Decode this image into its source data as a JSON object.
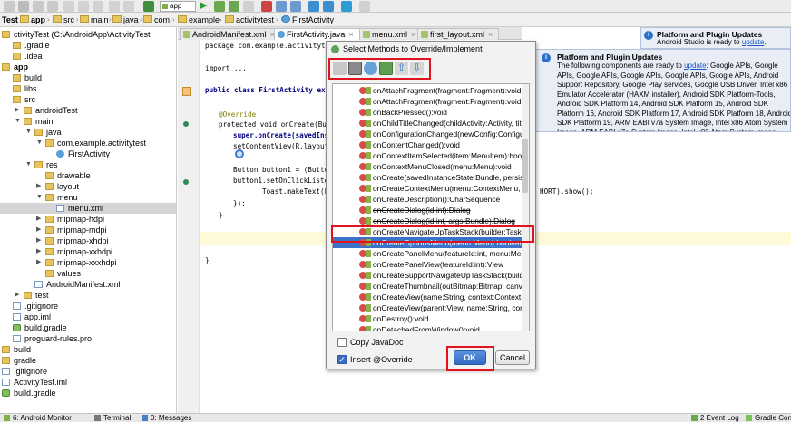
{
  "toolbar": {
    "run_config": "app"
  },
  "breadcrumb": [
    "Test",
    "app",
    "src",
    "main",
    "java",
    "com",
    "example",
    "activitytest",
    "FirstActivity"
  ],
  "editor_tabs": [
    {
      "label": "AndroidManifest.xml",
      "active": false
    },
    {
      "label": "FirstActivity.java",
      "active": true
    },
    {
      "label": "menu.xml",
      "active": false
    },
    {
      "label": "first_layout.xml",
      "active": false
    }
  ],
  "tree": [
    {
      "label": "ctivityTest (C:\\AndroidApp\\ActivityTest",
      "indent": 0,
      "icon": "folder",
      "arrow": ""
    },
    {
      "label": ".gradle",
      "indent": 1,
      "icon": "folder",
      "arrow": ""
    },
    {
      "label": ".idea",
      "indent": 1,
      "icon": "folder",
      "arrow": ""
    },
    {
      "label": "app",
      "indent": 0,
      "icon": "folder",
      "arrow": "▼",
      "bold": true
    },
    {
      "label": "build",
      "indent": 1,
      "icon": "folder",
      "arrow": ""
    },
    {
      "label": "libs",
      "indent": 1,
      "icon": "folder",
      "arrow": ""
    },
    {
      "label": "src",
      "indent": 1,
      "icon": "folder",
      "arrow": ""
    },
    {
      "label": "androidTest",
      "indent": 2,
      "icon": "folder",
      "arrow": "▶"
    },
    {
      "label": "main",
      "indent": 2,
      "icon": "folder",
      "arrow": "▼"
    },
    {
      "label": "java",
      "indent": 3,
      "icon": "folder",
      "arrow": "▼"
    },
    {
      "label": "com.example.activitytest",
      "indent": 4,
      "icon": "folder",
      "arrow": "▼"
    },
    {
      "label": "FirstActivity",
      "indent": 5,
      "icon": "java",
      "arrow": ""
    },
    {
      "label": "res",
      "indent": 3,
      "icon": "folder",
      "arrow": "▼"
    },
    {
      "label": "drawable",
      "indent": 4,
      "icon": "folder",
      "arrow": ""
    },
    {
      "label": "layout",
      "indent": 4,
      "icon": "folder",
      "arrow": "▶"
    },
    {
      "label": "menu",
      "indent": 4,
      "icon": "folder",
      "arrow": "▼"
    },
    {
      "label": "menu.xml",
      "indent": 5,
      "icon": "file",
      "arrow": "",
      "selected": true
    },
    {
      "label": "mipmap-hdpi",
      "indent": 4,
      "icon": "folder",
      "arrow": "▶"
    },
    {
      "label": "mipmap-mdpi",
      "indent": 4,
      "icon": "folder",
      "arrow": "▶"
    },
    {
      "label": "mipmap-xhdpi",
      "indent": 4,
      "icon": "folder",
      "arrow": "▶"
    },
    {
      "label": "mipmap-xxhdpi",
      "indent": 4,
      "icon": "folder",
      "arrow": "▶"
    },
    {
      "label": "mipmap-xxxhdpi",
      "indent": 4,
      "icon": "folder",
      "arrow": "▶"
    },
    {
      "label": "values",
      "indent": 4,
      "icon": "folder",
      "arrow": ""
    },
    {
      "label": "AndroidManifest.xml",
      "indent": 3,
      "icon": "file",
      "arrow": ""
    },
    {
      "label": "test",
      "indent": 2,
      "icon": "folder",
      "arrow": "▶"
    },
    {
      "label": ".gitignore",
      "indent": 1,
      "icon": "file",
      "arrow": ""
    },
    {
      "label": "app.iml",
      "indent": 1,
      "icon": "file",
      "arrow": ""
    },
    {
      "label": "build.gradle",
      "indent": 1,
      "icon": "gradle",
      "arrow": ""
    },
    {
      "label": "proguard-rules.pro",
      "indent": 1,
      "icon": "file",
      "arrow": ""
    },
    {
      "label": "build",
      "indent": 0,
      "icon": "folder",
      "arrow": ""
    },
    {
      "label": "gradle",
      "indent": 0,
      "icon": "folder",
      "arrow": ""
    },
    {
      "label": ".gitignore",
      "indent": 0,
      "icon": "file",
      "arrow": ""
    },
    {
      "label": "ActivityTest.iml",
      "indent": 0,
      "icon": "file",
      "arrow": ""
    },
    {
      "label": "build.gradle",
      "indent": 0,
      "icon": "gradle",
      "arrow": ""
    }
  ],
  "code": {
    "package_line": "package com.example.activitytest",
    "import_line": "import ...",
    "class_line": "public class FirstActivity exten",
    "override": "@Override",
    "oncreate": "protected void onCreate(Bund",
    "super_call": "super.onCreate(savedInsta",
    "setcontent": "setContentView(R.layout.f",
    "button_decl": "Button button1 = (Button)",
    "listener": "button1.setOnClickListene",
    "toast": "Toast.makeText(Fi",
    "toast_tail": "HORT).show();",
    "close1": "});",
    "close2": "}",
    "close3": "}"
  },
  "notifications": {
    "small": {
      "title": "Platform and Plugin Updates",
      "body": "Android Studio is ready to",
      "link": "update",
      "tail": "."
    },
    "big": {
      "title": "Platform and Plugin Updates",
      "body_prefix": "The following components are ready to",
      "link": "update",
      "body": ": Google APIs, Google APIs, Google APIs, Google APIs, Google APIs, Google APIs, Android Support Repository, Google Play services, Google USB Driver, Intel x86 Emulator Accelerator (HAXM installer), Android SDK Platform-Tools, Android SDK Platform 14, Android SDK Platform 15, Android SDK Platform 16, Android SDK Platform 17, Android SDK Platform 18, Android SDK Platform 19, ARM EABI v7a System Image, Intel x86 Atom System Image, ARM EABI v7a System Image, Intel x86 Atom System Image, ARM EABI v7a System Image, ARM EABI v7a System Image, ARM EABI v7a System Image"
    }
  },
  "dialog": {
    "title": "Select Methods to Override/Implement",
    "methods": [
      {
        "text": "onAttachFragment(fragment:Fragment):void",
        "strike": false
      },
      {
        "text": "onAttachFragment(fragment:Fragment):void",
        "strike": false
      },
      {
        "text": "onBackPressed():void",
        "strike": false
      },
      {
        "text": "onChildTitleChanged(childActivity:Activity, title",
        "strike": false
      },
      {
        "text": "onConfigurationChanged(newConfig:Configura",
        "strike": false
      },
      {
        "text": "onContentChanged():void",
        "strike": false
      },
      {
        "text": "onContextItemSelected(item:MenuItem):boole",
        "strike": false
      },
      {
        "text": "onContextMenuClosed(menu:Menu):void",
        "strike": false
      },
      {
        "text": "onCreate(savedInstanceState:Bundle, persisten",
        "strike": false
      },
      {
        "text": "onCreateContextMenu(menu:ContextMenu, v:",
        "strike": false
      },
      {
        "text": "onCreateDescription():CharSequence",
        "strike": false
      },
      {
        "text": "onCreateDialog(id:int):Dialog",
        "strike": true
      },
      {
        "text": "onCreateDialog(id:int, args:Bundle):Dialog",
        "strike": true
      },
      {
        "text": "onCreateNavigateUpTaskStack(builder:TaskSta",
        "strike": false
      },
      {
        "text": "onCreateOptionsMenu(menu:Menu):boolean",
        "strike": false,
        "selected": true
      },
      {
        "text": "onCreatePanelMenu(featureId:int, menu:Menu",
        "strike": false
      },
      {
        "text": "onCreatePanelView(featureId:int):View",
        "strike": false
      },
      {
        "text": "onCreateSupportNavigateUpTaskStack(builder",
        "strike": false
      },
      {
        "text": "onCreateThumbnail(outBitmap:Bitmap, canvas:",
        "strike": false
      },
      {
        "text": "onCreateView(name:String, context:Context, a",
        "strike": false
      },
      {
        "text": "onCreateView(parent:View, name:String, conte",
        "strike": false
      },
      {
        "text": "onDestroy():void",
        "strike": false
      },
      {
        "text": "onDetachedFromWindow():void",
        "strike": false
      }
    ],
    "copy_javadoc": {
      "label": "Copy JavaDoc",
      "checked": false
    },
    "insert_override": {
      "label": "Insert @Override",
      "checked": true
    },
    "ok_label": "OK",
    "cancel_label": "Cancel"
  },
  "statusbar": {
    "items": [
      "6: Android Monitor",
      "Terminal",
      "0: Messages"
    ],
    "right_items": [
      "2 Event Log",
      "Gradle Cons"
    ]
  },
  "colors": {
    "highlight_box": "#e0141e",
    "selection": "#3b73c9",
    "ok_button": "#2f68c2"
  }
}
